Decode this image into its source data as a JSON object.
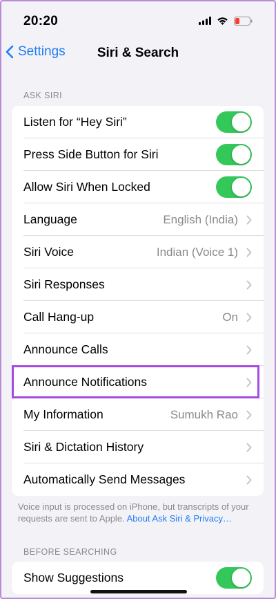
{
  "status": {
    "time": "20:20",
    "icons": [
      "signal-icon",
      "wifi-icon",
      "battery-icon"
    ],
    "battery_color": "#ff3b30"
  },
  "nav": {
    "back_label": "Settings",
    "title": "Siri & Search"
  },
  "sections": {
    "ask_siri_header": "ASK SIRI",
    "before_searching_header": "BEFORE SEARCHING"
  },
  "ask_siri": {
    "listen_hey_siri": {
      "label": "Listen for “Hey Siri”",
      "toggle": "on"
    },
    "press_side_button": {
      "label": "Press Side Button for Siri",
      "toggle": "on"
    },
    "allow_when_locked": {
      "label": "Allow Siri When Locked",
      "toggle": "on"
    },
    "language": {
      "label": "Language",
      "value": "English (India)"
    },
    "siri_voice": {
      "label": "Siri Voice",
      "value": "Indian (Voice 1)"
    },
    "siri_responses": {
      "label": "Siri Responses"
    },
    "call_hangup": {
      "label": "Call Hang-up",
      "value": "On"
    },
    "announce_calls": {
      "label": "Announce Calls"
    },
    "announce_notifications": {
      "label": "Announce Notifications"
    },
    "my_information": {
      "label": "My Information",
      "value": "Sumukh Rao"
    },
    "dictation_history": {
      "label": "Siri & Dictation History"
    },
    "auto_send": {
      "label": "Automatically Send Messages"
    }
  },
  "footer": {
    "text": "Voice input is processed on iPhone, but transcripts of your requests are sent to Apple. ",
    "link": "About Ask Siri & Privacy…"
  },
  "before_searching": {
    "show_suggestions": {
      "label": "Show Suggestions",
      "toggle": "on"
    }
  },
  "colors": {
    "accent": "#1f7cf4",
    "toggle_on": "#34c759",
    "highlight": "#a54ae0"
  }
}
